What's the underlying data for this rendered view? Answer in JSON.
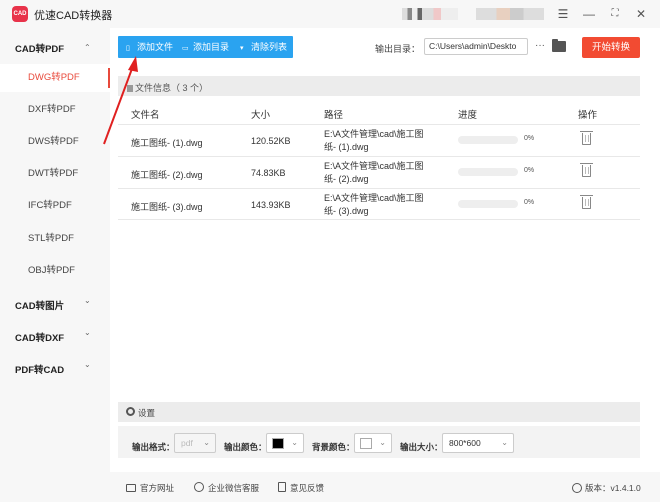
{
  "app": {
    "title": "优速CAD转换器",
    "logo_text": "CAD",
    "accent": "#e8334a"
  },
  "sidebar": {
    "groups": [
      {
        "label": "CAD转PDF",
        "expanded": true
      },
      {
        "label": "CAD转图片",
        "expanded": false
      },
      {
        "label": "CAD转DXF",
        "expanded": false
      },
      {
        "label": "PDF转CAD",
        "expanded": false
      }
    ],
    "items": [
      "DWG转PDF",
      "DXF转PDF",
      "DWS转PDF",
      "DWT转PDF",
      "IFC转PDF",
      "STL转PDF",
      "OBJ转PDF"
    ],
    "active_item": "DWG转PDF",
    "chevrons": {
      "up": "⌃",
      "down": "⌄"
    }
  },
  "toolbar": {
    "add_file": "添加文件",
    "add_folder": "添加目录",
    "clear_list": "清除列表",
    "output_label": "输出目录：",
    "output_path": "C:\\Users\\admin\\Deskto",
    "more": "···",
    "start": "开始转换"
  },
  "file_panel": {
    "header": "文件信息（ 3 个）",
    "columns": [
      "文件名",
      "大小",
      "路径",
      "进度",
      "操作"
    ],
    "rows": [
      {
        "name": "施工图纸- (1).dwg",
        "size": "120.52KB",
        "path1": "E:\\A文件管理\\cad\\施工图",
        "path2": "纸- (1).dwg",
        "progress": 0,
        "progress_label": "0%"
      },
      {
        "name": "施工图纸- (2).dwg",
        "size": "74.83KB",
        "path1": "E:\\A文件管理\\cad\\施工图",
        "path2": "纸- (2).dwg",
        "progress": 0,
        "progress_label": "0%"
      },
      {
        "name": "施工图纸- (3).dwg",
        "size": "143.93KB",
        "path1": "E:\\A文件管理\\cad\\施工图",
        "path2": "纸- (3).dwg",
        "progress": 0,
        "progress_label": "0%"
      }
    ]
  },
  "settings": {
    "title": "设置",
    "format_label": "输出格式：",
    "format_value": "pdf",
    "color_label": "输出颜色：",
    "color_value": "#000000",
    "bg_label": "背景颜色：",
    "bg_value": "#ffffff",
    "size_label": "输出大小：",
    "size_value": "800*600",
    "chevron": "⌄"
  },
  "footer": {
    "website": "官方网址",
    "wechat": "企业微信客服",
    "feedback": "意见反馈",
    "version": "版本：v1.4.1.0"
  },
  "window": {
    "menu": "☰",
    "minimize": "—",
    "maximize": "⛶",
    "close": "✕"
  }
}
